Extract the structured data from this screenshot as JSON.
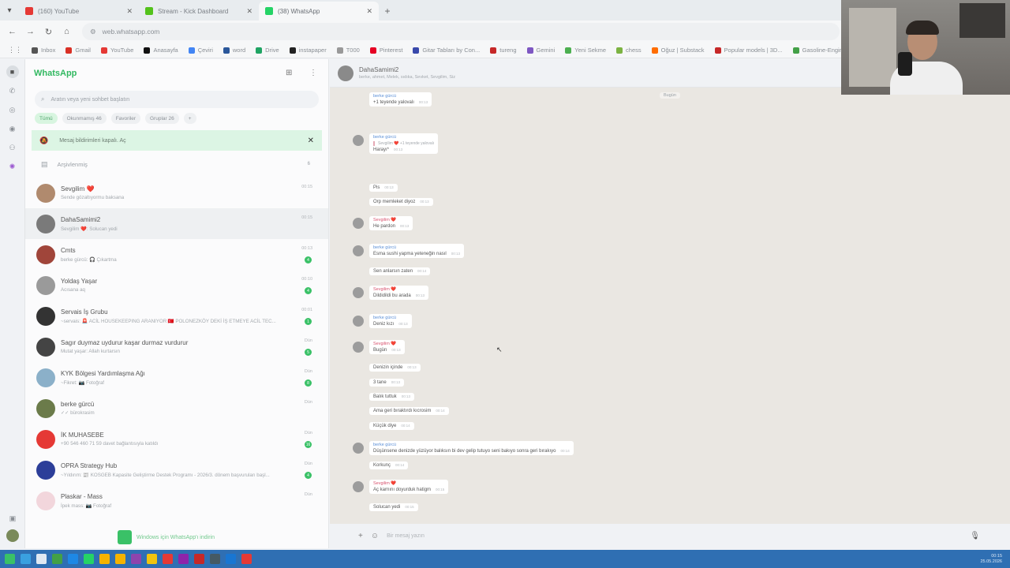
{
  "browser": {
    "tabs": [
      {
        "label": "(160) YouTube",
        "color": "#e53935"
      },
      {
        "label": "Stream - Kick Dashboard",
        "color": "#53c21b"
      },
      {
        "label": "(38) WhatsApp",
        "color": "#25d366"
      }
    ],
    "url": "web.whatsapp.com",
    "bookmarks": [
      {
        "label": "Inbox",
        "color": "#555"
      },
      {
        "label": "Gmail",
        "color": "#d93025"
      },
      {
        "label": "YouTube",
        "color": "#e53935"
      },
      {
        "label": "Anasayfa",
        "color": "#111"
      },
      {
        "label": "Çeviri",
        "color": "#4285f4"
      },
      {
        "label": "word",
        "color": "#2b579a"
      },
      {
        "label": "Drive",
        "color": "#1fa463"
      },
      {
        "label": "instapaper",
        "color": "#222"
      },
      {
        "label": "T000",
        "color": "#999"
      },
      {
        "label": "Pinterest",
        "color": "#e60023"
      },
      {
        "label": "Gitar Tabları by Con...",
        "color": "#3949ab"
      },
      {
        "label": "tureng",
        "color": "#c62828"
      },
      {
        "label": "Gemini",
        "color": "#7e57c2"
      },
      {
        "label": "Yeni Sekme",
        "color": "#4caf50"
      },
      {
        "label": "chess",
        "color": "#7cb342"
      },
      {
        "label": "Oğuz | Substack",
        "color": "#ff6d00"
      },
      {
        "label": "Popular models | 3D...",
        "color": "#c62828"
      },
      {
        "label": "Gasoline-Engine",
        "color": "#43a047"
      }
    ]
  },
  "sidebar": {
    "title": "WhatsApp",
    "search_placeholder": "Aratın veya yeni sohbet başlatın",
    "filters": [
      "Tümü",
      "Okunmamış 46",
      "Favoriler",
      "Gruplar 26",
      "+"
    ],
    "banner": "Mesaj bildirimleri kapalı. Aç",
    "archived_label": "Arşivlenmiş",
    "archived_count": "6",
    "chats": [
      {
        "name": "Sevgilim ❤️",
        "preview": "Sende gözaltıyormu baksana",
        "time": "00:15",
        "badge": "",
        "color": "#b08a6e"
      },
      {
        "name": "DahaSamimi2",
        "preview": "Sevgilim ❤️: Solucan yedi",
        "time": "00:15",
        "badge": "",
        "color": "#7a7a7a"
      },
      {
        "name": "Cmts",
        "preview": "berke gürcü: 🎧 Çıkartma",
        "time": "00:13",
        "badge": "4",
        "color": "#a0453a"
      },
      {
        "name": "Yoldaş Yaşar",
        "preview": "Acısana aq",
        "time": "00:10",
        "badge": "4",
        "color": "#9a9a9a"
      },
      {
        "name": "Servais İş Grubu",
        "preview": "~servais: 🚨 ACİL HOUSEKEEPING ARANIYOR 🇹🇷 POLONEZKÖY DEKİ İŞ ETMEYE ACİL TEC...",
        "time": "00:01",
        "badge": "1",
        "color": "#333333"
      },
      {
        "name": "Sagır duymaz uydurur kaşar durmaz vurdurur",
        "preview": "Mutat yaşar: Allah kurtarsın",
        "time": "Dün",
        "badge": "5",
        "color": "#444444"
      },
      {
        "name": "KYK Bölgesi Yardımlaşma Ağı",
        "preview": "~Fikret: 📷 Fotoğraf",
        "time": "Dün",
        "badge": "8",
        "color": "#8bb0c9"
      },
      {
        "name": "berke gürcü",
        "preview": "✓✓ bürokrasim",
        "time": "Dün",
        "badge": "",
        "color": "#6b7b4a"
      },
      {
        "name": "İK MUHASEBE",
        "preview": "+90 546 460 71 59 davet bağlantısıyla katıldı",
        "time": "Dün",
        "badge": "16",
        "color": "#e53935"
      },
      {
        "name": "OPRA Strategy Hub",
        "preview": "~Yıldırım: 📰 KOSGEB Kapasite Geliştirme Destek Programı - 2026/3. dönem başvuruları başl...",
        "time": "Dün",
        "badge": "4",
        "color": "#2c3e99"
      },
      {
        "name": "Plaskar - Mass",
        "preview": "İpek mass: 📷 Fotoğraf",
        "time": "Dün",
        "badge": "",
        "color": "#f2d6dc"
      }
    ],
    "download_label": "Windows için WhatsApp'ı indirin"
  },
  "conversation": {
    "name": "DahaSamimi2",
    "members": "berke, ahmet, Melek, sıdıka, Sevket, Sevgilim, Siz",
    "day_label": "Bugün",
    "composer_placeholder": "Bir mesaj yazın",
    "messages": [
      {
        "sender": "berke gürcü",
        "text": "+1 teyende yalovalı",
        "time": "00:13",
        "quote": "",
        "avatar": false
      },
      {
        "sender": "berke gürcü",
        "text": "Harayı*",
        "time": "00:13",
        "quote": "Sevgilim ❤️ +1 teyende yalovalı",
        "avatar": true
      },
      {
        "sender": "",
        "text": "Pis",
        "time": "00:13",
        "quote": "",
        "avatar": false
      },
      {
        "sender": "",
        "text": "Orp memleket diyoz",
        "time": "00:13",
        "quote": "",
        "avatar": false
      },
      {
        "sender": "Sevgilim ❤️",
        "text": "He pardon",
        "time": "00:13",
        "quote": "",
        "avatar": true
      },
      {
        "sender": "berke gürcü",
        "text": "Esma sushi yapma yeteneğin nasıl",
        "time": "00:13",
        "quote": "",
        "avatar": true
      },
      {
        "sender": "",
        "text": "Sen anlarsın zaten",
        "time": "00:14",
        "quote": "",
        "avatar": false
      },
      {
        "sender": "Sevgilim ❤️",
        "text": "Dildidildi bu arada",
        "time": "00:13",
        "quote": "",
        "avatar": true
      },
      {
        "sender": "berke gürcü",
        "text": "Deniz kızı",
        "time": "00:13",
        "quote": "",
        "avatar": true
      },
      {
        "sender": "Sevgilim ❤️",
        "text": "Bugün",
        "time": "00:13",
        "quote": "",
        "avatar": true
      },
      {
        "sender": "",
        "text": "Denizin içinde",
        "time": "00:13",
        "quote": "",
        "avatar": false
      },
      {
        "sender": "",
        "text": "3 tane",
        "time": "00:13",
        "quote": "",
        "avatar": false
      },
      {
        "sender": "",
        "text": "Balık tuttuk",
        "time": "00:13",
        "quote": "",
        "avatar": false
      },
      {
        "sender": "",
        "text": "Ama geri bıraktırdı kıcrosim",
        "time": "00:14",
        "quote": "",
        "avatar": false
      },
      {
        "sender": "",
        "text": "Küçük diye",
        "time": "00:14",
        "quote": "",
        "avatar": false
      },
      {
        "sender": "berke gürcü",
        "text": "Düşünsene denizde yüzüyor balıksın bi dev gelip tutuyo seni bakıyo sonra geri bırakıyo",
        "time": "00:14",
        "quote": "",
        "avatar": true
      },
      {
        "sender": "",
        "text": "Korkunç",
        "time": "00:14",
        "quote": "",
        "avatar": false
      },
      {
        "sender": "Sevgilim ❤️",
        "text": "Aç karnını doyurduk hatigm",
        "time": "00:15",
        "quote": "",
        "avatar": true
      },
      {
        "sender": "",
        "text": "Solucan yedi",
        "time": "00:15",
        "quote": "",
        "avatar": false
      }
    ]
  },
  "taskbar": {
    "time": "00:15",
    "date": "25.05.2026"
  }
}
